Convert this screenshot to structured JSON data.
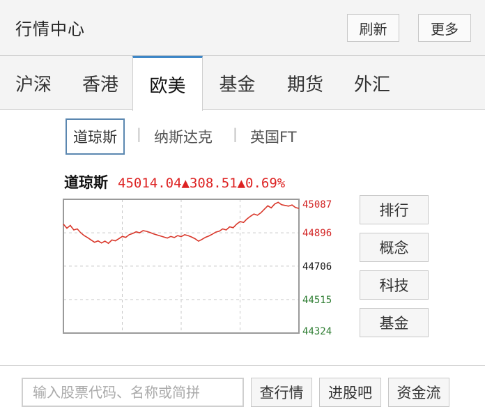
{
  "header": {
    "title": "行情中心",
    "refresh_label": "刷新",
    "more_label": "更多"
  },
  "tabs": [
    {
      "label": "沪深"
    },
    {
      "label": "香港"
    },
    {
      "label": "欧美",
      "active": true
    },
    {
      "label": "基金"
    },
    {
      "label": "期货"
    },
    {
      "label": "外汇"
    }
  ],
  "subtabs": [
    {
      "label": "道琼斯",
      "active": true
    },
    {
      "label": "纳斯达克"
    },
    {
      "label": "英国FT"
    }
  ],
  "separator": "|",
  "index": {
    "name": "道琼斯",
    "value": "45014.04",
    "change": "▲308.51",
    "change_pct": "▲0.69%"
  },
  "side_buttons": [
    {
      "label": "排行"
    },
    {
      "label": "概念"
    },
    {
      "label": "科技"
    },
    {
      "label": "基金"
    }
  ],
  "footer": {
    "search_placeholder": "输入股票代码、名称或简拼",
    "buttons": [
      {
        "label": "查行情"
      },
      {
        "label": "进股吧"
      },
      {
        "label": "资金流"
      }
    ]
  },
  "colors": {
    "accent": "#3d86c6",
    "up": "#d22222",
    "down_axis": "#2e7d32",
    "line": "#d9372a"
  },
  "chart_data": {
    "type": "line",
    "series": [
      {
        "values": [
          44945,
          44922,
          44938,
          44912,
          44918,
          44896,
          44880,
          44868,
          44855,
          44842,
          44850,
          44838,
          44848,
          44836,
          44855,
          44850,
          44862,
          44875,
          44870,
          44885,
          44892,
          44902,
          44896,
          44908,
          44904,
          44898,
          44890,
          44884,
          44878,
          44872,
          44866,
          44875,
          44869,
          44880,
          44874,
          44885,
          44880,
          44872,
          44862,
          44848,
          44858,
          44870,
          44878,
          44888,
          44900,
          44905,
          44918,
          44912,
          44930,
          44925,
          44945,
          44960,
          44955,
          44975,
          44990,
          45003,
          44996,
          45010,
          45030,
          45050,
          45038,
          45060,
          45070,
          45056,
          45052,
          45048,
          45055,
          45040,
          45035
        ]
      }
    ],
    "y_ticks": [
      45087,
      44896,
      44706,
      44515,
      44324
    ],
    "ylim": [
      44324,
      45087
    ],
    "grid": true
  }
}
